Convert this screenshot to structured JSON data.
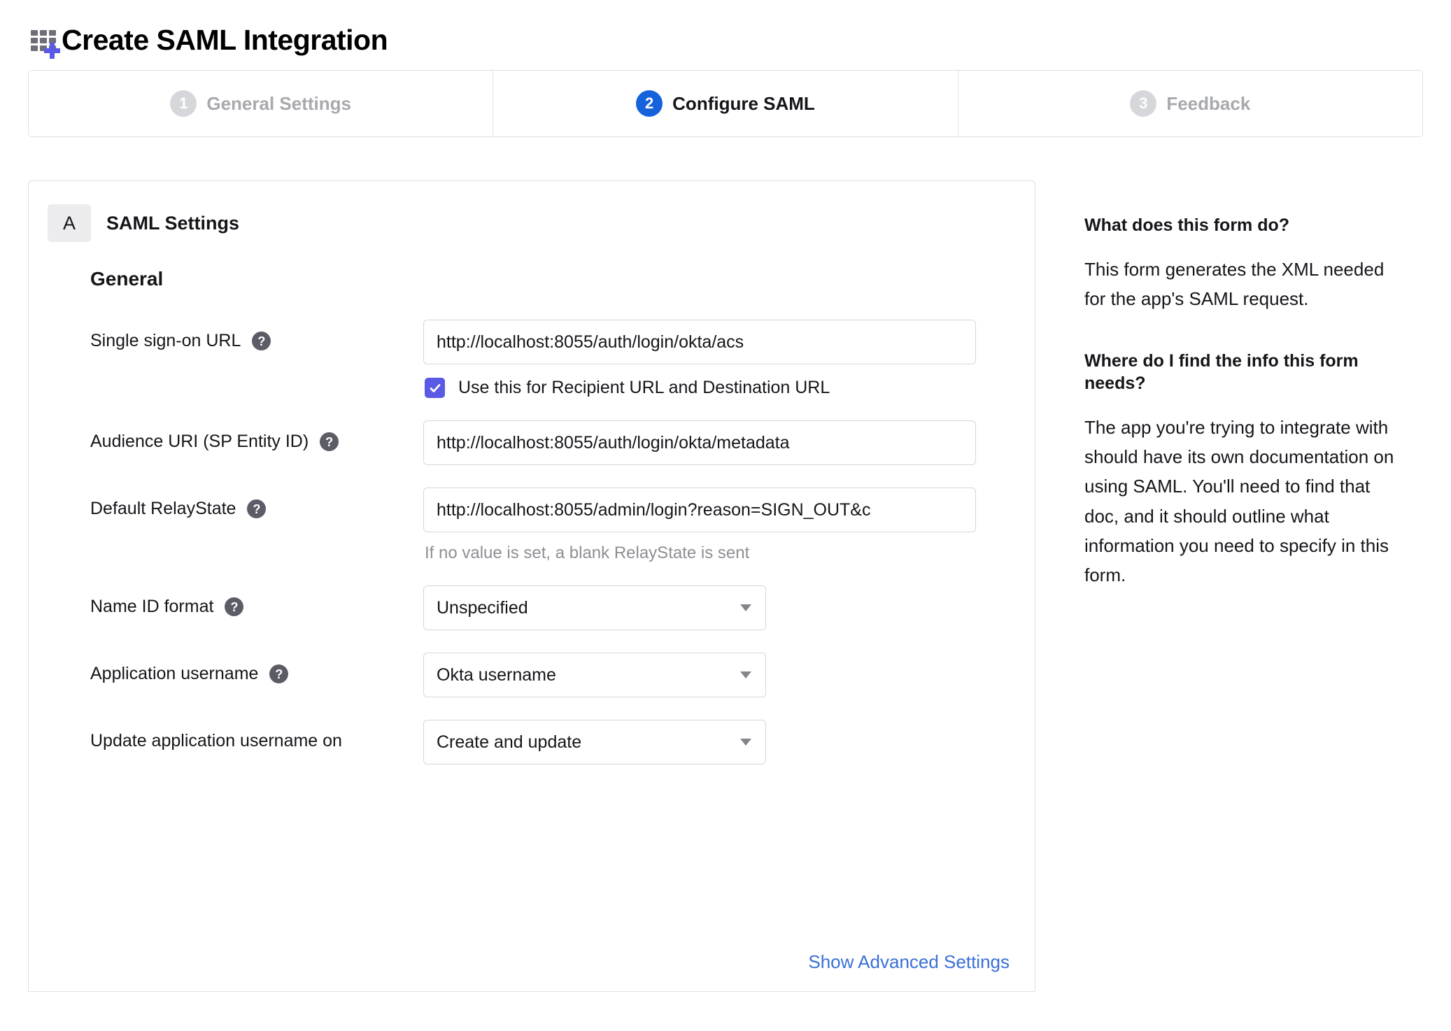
{
  "header": {
    "title": "Create SAML Integration",
    "icon": "app-grid-plus-icon"
  },
  "stepper": {
    "steps": [
      {
        "number": "1",
        "label": "General Settings",
        "state": "inactive"
      },
      {
        "number": "2",
        "label": "Configure SAML",
        "state": "active"
      },
      {
        "number": "3",
        "label": "Feedback",
        "state": "inactive"
      }
    ]
  },
  "card": {
    "badge": "A",
    "title": "SAML Settings",
    "section_title": "General",
    "advanced_link": "Show Advanced Settings",
    "help_icon_glyph": "?",
    "fields": {
      "sso_url": {
        "label": "Single sign-on URL",
        "value": "http://localhost:8055/auth/login/okta/acs",
        "placeholder": "",
        "checkbox_label": "Use this for Recipient URL and Destination URL",
        "checkbox_checked": "true"
      },
      "audience_uri": {
        "label": "Audience URI (SP Entity ID)",
        "value": "http://localhost:8055/auth/login/okta/metadata",
        "placeholder": ""
      },
      "default_relaystate": {
        "label": "Default RelayState",
        "value": "http://localhost:8055/admin/login?reason=SIGN_OUT&c",
        "placeholder": "",
        "hint": "If no value is set, a blank RelayState is sent"
      },
      "name_id_format": {
        "label": "Name ID format",
        "value": "Unspecified"
      },
      "application_username": {
        "label": "Application username",
        "value": "Okta username"
      },
      "update_application_username_on": {
        "label": "Update application username on",
        "value": "Create and update"
      }
    }
  },
  "help_panel": {
    "q1_title": "What does this form do?",
    "q1_body": "This form generates the XML needed for the app's SAML request.",
    "q2_title": "Where do I find the info this form needs?",
    "q2_body": "The app you're trying to integrate with should have its own documentation on using SAML. You'll need to find that doc, and it should outline what information you need to specify in this form."
  },
  "colors": {
    "accent_blue": "#1662dd",
    "link_blue": "#3a6fd8",
    "checkbox_indigo": "#5a5ae6",
    "muted_gray": "#a7a9ad"
  }
}
